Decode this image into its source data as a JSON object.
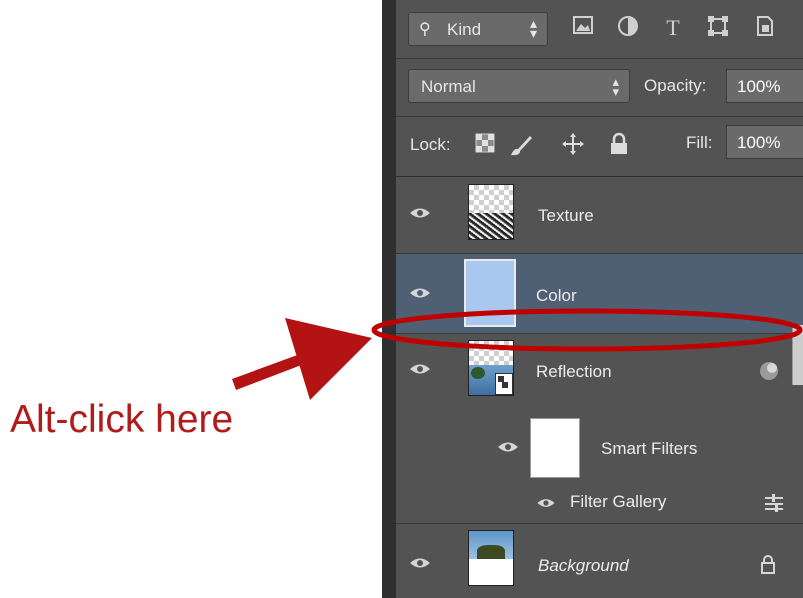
{
  "annotation": {
    "text": "Alt-click here",
    "color": "#b11b1b"
  },
  "filter_bar": {
    "kind_label": "Kind",
    "search_icon": "search-icon",
    "filter_icons": [
      "pixel-layer-filter-icon",
      "adjustment-layer-filter-icon",
      "type-layer-filter-icon",
      "shape-layer-filter-icon",
      "smart-object-filter-icon"
    ]
  },
  "blend_bar": {
    "mode": "Normal",
    "opacity_label": "Opacity:",
    "opacity_value": "100%"
  },
  "lock_bar": {
    "label": "Lock:",
    "fill_label": "Fill:",
    "fill_value": "100%"
  },
  "layers": [
    {
      "name": "Texture",
      "selected": false
    },
    {
      "name": "Color",
      "selected": true
    },
    {
      "name": "Reflection",
      "selected": false
    },
    {
      "name": "Smart Filters",
      "selected": false
    },
    {
      "name": "Filter Gallery",
      "selected": false
    },
    {
      "name": "Background",
      "selected": false,
      "italic": true,
      "locked": true
    }
  ],
  "colors": {
    "panel_bg": "#535353",
    "selected_row": "#4f5f74",
    "color_fill": "#a9c8ef",
    "highlight_ellipse": "#c00000"
  }
}
